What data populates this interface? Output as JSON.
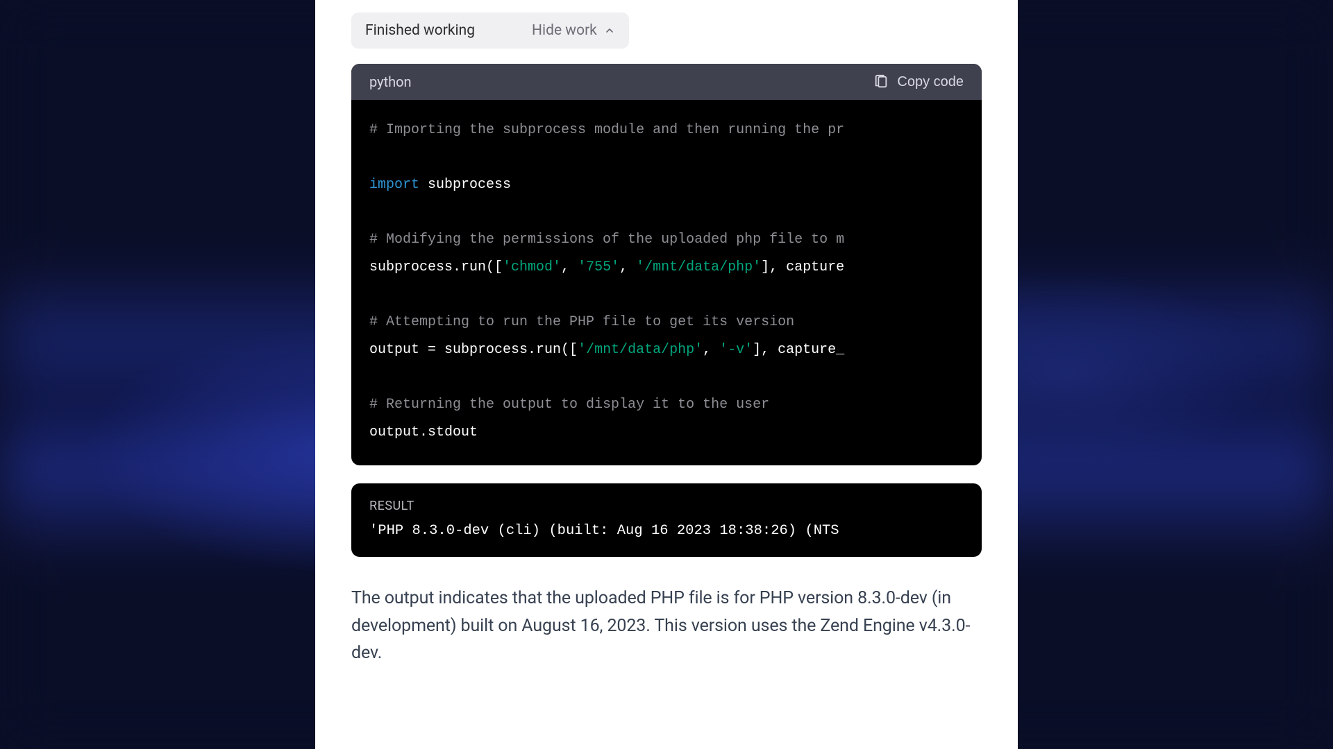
{
  "status": {
    "label": "Finished working",
    "hide_label": "Hide work"
  },
  "code": {
    "language": "python",
    "copy_label": "Copy code",
    "lines": {
      "c1": "# Importing the subprocess module and then running the pr",
      "kw_import": "import",
      "mod": " subprocess",
      "c2": "# Modifying the permissions of the uploaded php file to m",
      "l3a": "subprocess.run([",
      "l3s1": "'chmod'",
      "l3b": ", ",
      "l3s2": "'755'",
      "l3c": ", ",
      "l3s3": "'/mnt/data/php'",
      "l3d": "], capture",
      "c3": "# Attempting to run the PHP file to get its version",
      "l5a": "output = subprocess.run([",
      "l5s1": "'/mnt/data/php'",
      "l5b": ", ",
      "l5s2": "'-v'",
      "l5c": "], capture_",
      "c4": "# Returning the output to display it to the user",
      "l7": "output.stdout"
    }
  },
  "result": {
    "label": "RESULT",
    "text": "'PHP 8.3.0-dev (cli) (built: Aug 16 2023 18:38:26) (NTS"
  },
  "description": "The output indicates that the uploaded PHP file is for PHP version 8.3.0-dev (in development) built on August 16, 2023. This version uses the Zend Engine v4.3.0-dev."
}
